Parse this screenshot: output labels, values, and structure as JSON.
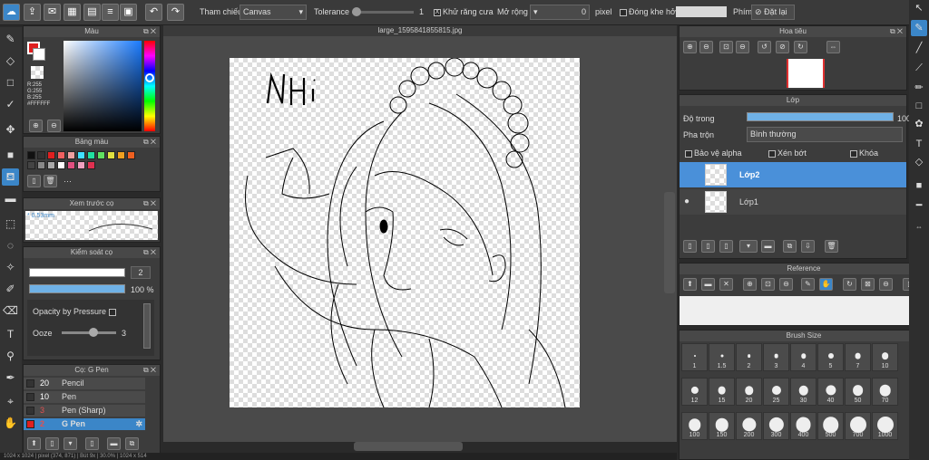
{
  "toolbar": {
    "reference_label": "Tham chiếu",
    "reference_value": "Canvas",
    "tolerance_label": "Tolerance",
    "tolerance_value": "1",
    "antialias_label": "Khử răng cưa",
    "antialias_mark": "X",
    "expand_label": "Mở rộng",
    "expand_value": "0",
    "expand_unit": "pixel",
    "close_gap_label": "Đóng khe hở",
    "key_label": "Phím",
    "reset_label": "Đặt lại"
  },
  "left": {
    "color_title": "Màu",
    "r_value": "R:255",
    "g_value": "G:255",
    "b_value": "B:255",
    "hex_value": "#FFFFFF",
    "palette_title": "Bảng màu",
    "palette_more": "···",
    "brush_preview_title": "Xem trước cọ",
    "brush_preview_size": "* 0.53mm",
    "brush_control_title": "Kiểm soát cọ",
    "size_value": "2",
    "opacity_value": "100 %",
    "opacity_pressure_label": "Opacity by Pressure",
    "ooze_label": "Ooze",
    "ooze_value": "3",
    "brush_list_title": "Cọ: G Pen",
    "brushes": [
      {
        "size": "20",
        "name": "Pencil",
        "size_color": "#ffffff"
      },
      {
        "size": "10",
        "name": "Pen",
        "size_color": "#ffffff"
      },
      {
        "size": "3",
        "name": "Pen (Sharp)",
        "size_color": "#e05050"
      },
      {
        "size": "2",
        "name": "G Pen",
        "size_color": "#e05050"
      }
    ]
  },
  "canvas": {
    "file_name": "large_1595841855815.jpg"
  },
  "right": {
    "navigator_title": "Hoa tiêu",
    "layer_title": "Lớp",
    "opacity_label": "Độ trong",
    "opacity_value": "100",
    "blend_label": "Pha trộn",
    "blend_value": "Bình thường",
    "protect_alpha_label": "Bảo vệ alpha",
    "clipping_label": "Xén bớt",
    "lock_label": "Khóa",
    "layers": [
      {
        "name": "Lớp2"
      },
      {
        "name": "Lớp1"
      }
    ],
    "reference_title": "Reference",
    "brush_size_title": "Brush Size",
    "brush_sizes": [
      "1",
      "1.5",
      "2",
      "3",
      "4",
      "5",
      "7",
      "10",
      "12",
      "15",
      "20",
      "25",
      "30",
      "40",
      "50",
      "70",
      "100",
      "150",
      "200",
      "300",
      "400",
      "500",
      "700",
      "1000"
    ]
  },
  "status": {
    "text": "1024 x 1024 | pixel (374, 871) | Bút 9x | 30.0% | 1024 x 514"
  },
  "colors": {
    "accent": "#3b86c8",
    "panel_bg": "#3c3c3c",
    "foreground": "#e02020",
    "background": "#ffffff"
  }
}
